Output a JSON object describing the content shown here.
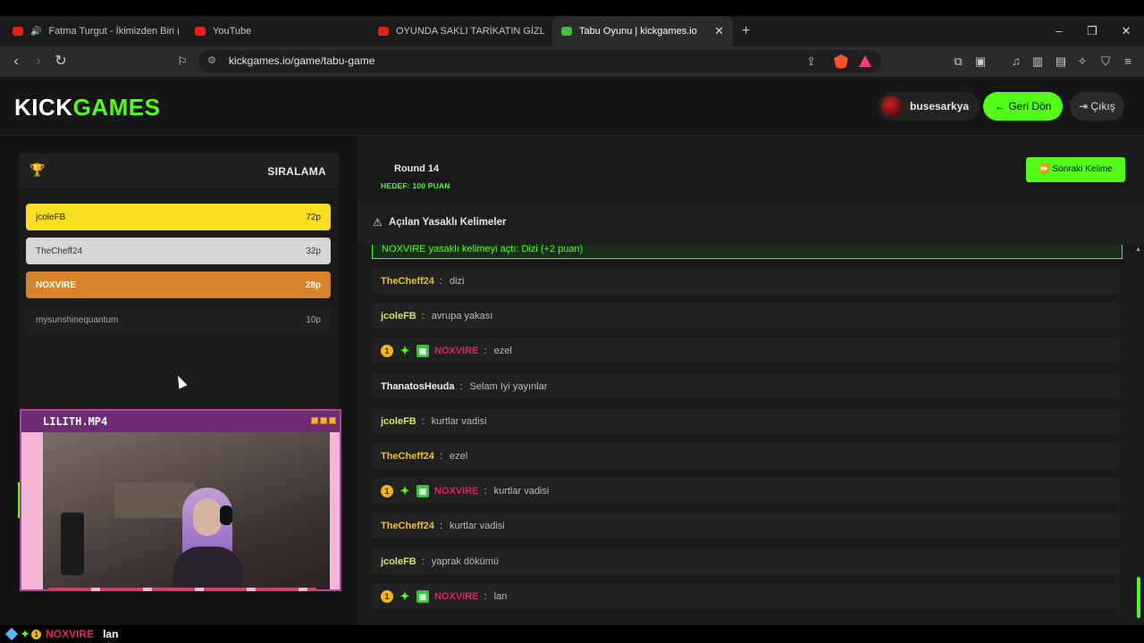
{
  "browser": {
    "tabs": [
      {
        "title": "Fatma Turgut - İkimizden Biri (Ca",
        "favicon": "youtube"
      },
      {
        "title": "YouTube",
        "favicon": "youtube"
      },
      {
        "title": "OYUNDA SAKLI TARİKATIN GİZLİ SIRI",
        "favicon": "youtube"
      },
      {
        "title": "Tabu Oyunu | kickgames.io",
        "favicon": "kickgames",
        "active": true
      }
    ],
    "url": "kickgames.io/game/tabu-game"
  },
  "header": {
    "logo_kick": "KICK",
    "logo_games": "GAMES",
    "username": "busesarkya",
    "back_label": "← Geri Dön",
    "exit_label": "⇥ Çıkış"
  },
  "ranking": {
    "title": "SIRALAMA",
    "rows": [
      {
        "name": "jcoleFB",
        "points": "72p"
      },
      {
        "name": "TheCheff24",
        "points": "32p"
      },
      {
        "name": "NOXVIRE",
        "points": "28p"
      },
      {
        "name": "mysunshinequantum",
        "points": "10p"
      }
    ]
  },
  "camera": {
    "title": "LILITH.MP4"
  },
  "game": {
    "round": "Round 14",
    "target": "HEDEF: 100 PUAN",
    "next_label": "⏩ Sonraki Kelime",
    "forbidden_title": "Açılan Yasaklı Kelimeler",
    "system_message": "NOXVIRE yasaklı kelimeyi açtı: Dizi (+2 puan)"
  },
  "chat": [
    {
      "user": "TheCheff24",
      "text": "dizi",
      "color": "#e6c22c",
      "badges": false
    },
    {
      "user": "jcoleFB",
      "text": "avrupa yakası",
      "color": "#d8e46a",
      "badges": false
    },
    {
      "user": "NOXVIRE",
      "text": "ezel",
      "color": "#e0245e",
      "badges": true
    },
    {
      "user": "ThanatosHeuda",
      "text": "Selam Iyi yayınlar",
      "color": "#f0f0f0",
      "badges": false
    },
    {
      "user": "jcoleFB",
      "text": "kurtlar vadisi",
      "color": "#d8e46a",
      "badges": false
    },
    {
      "user": "TheCheff24",
      "text": "ezel",
      "color": "#e6c22c",
      "badges": false
    },
    {
      "user": "NOXVIRE",
      "text": "kurtlar vadisi",
      "color": "#e0245e",
      "badges": true
    },
    {
      "user": "TheCheff24",
      "text": "kurtlar vadisi",
      "color": "#e6c22c",
      "badges": false
    },
    {
      "user": "jcoleFB",
      "text": "yaprak dökümü",
      "color": "#d8e46a",
      "badges": false
    },
    {
      "user": "NOXVIRE",
      "text": "lan",
      "color": "#e0245e",
      "badges": true
    }
  ],
  "chat_separator": ":",
  "badge_one": "1",
  "overlay": {
    "user": "NOXVIRE",
    "text": "lan"
  },
  "colors": {
    "accent": "#53fc18",
    "background": "#0f0f0f"
  }
}
